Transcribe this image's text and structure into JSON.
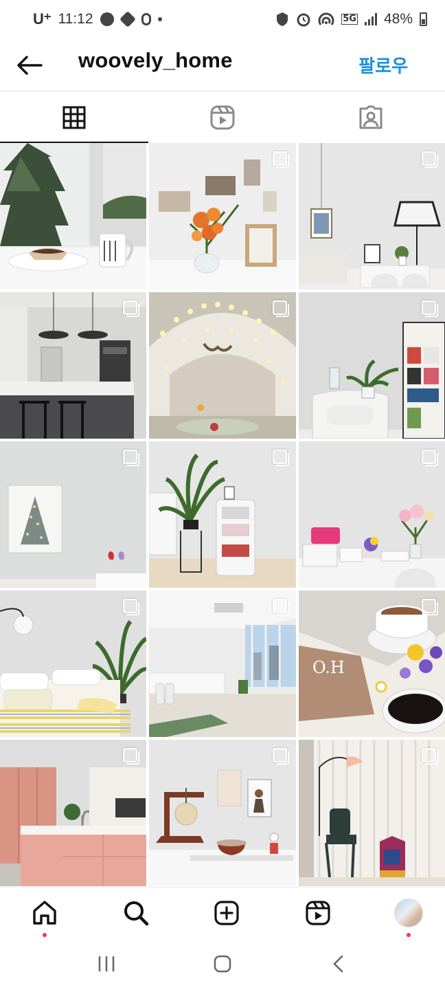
{
  "status_bar": {
    "carrier": "U⁺",
    "time": "11:12",
    "network": "5G",
    "battery": "48%"
  },
  "header": {
    "username": "woovely_home",
    "follow_label": "팔로우",
    "accent_color": "#1a8fe3"
  },
  "tabs": [
    {
      "name": "posts-grid",
      "icon": "grid-icon",
      "active": true
    },
    {
      "name": "reels",
      "icon": "reels-icon",
      "active": false
    },
    {
      "name": "tagged",
      "icon": "tagged-person-icon",
      "active": false
    }
  ],
  "posts": [
    {
      "desc": "christmas-tree-mug",
      "multi": false
    },
    {
      "desc": "orange-flowers-vase",
      "multi": true
    },
    {
      "desc": "lamp-wall-frame",
      "multi": true
    },
    {
      "desc": "kitchen-pendant-lights",
      "multi": true
    },
    {
      "desc": "string-light-tent",
      "multi": true
    },
    {
      "desc": "plant-poster-shelf",
      "multi": true
    },
    {
      "desc": "christmas-tree-canvas",
      "multi": true
    },
    {
      "desc": "palm-plant-drawers",
      "multi": true
    },
    {
      "desc": "flowers-pink-box",
      "multi": true
    },
    {
      "desc": "bedroom-yellow-bedding",
      "multi": true
    },
    {
      "desc": "bright-empty-room",
      "multi": true
    },
    {
      "desc": "coffee-flowers-magazine",
      "multi": true
    },
    {
      "desc": "pink-kitchen-island",
      "multi": true
    },
    {
      "desc": "lamp-tea-desk",
      "multi": true
    },
    {
      "desc": "chair-curtain-window",
      "multi": true
    }
  ],
  "bottom_nav": [
    {
      "name": "home",
      "icon": "home-icon",
      "notification_dot": true
    },
    {
      "name": "search",
      "icon": "search-icon",
      "notification_dot": false
    },
    {
      "name": "create",
      "icon": "add-post-icon",
      "notification_dot": false
    },
    {
      "name": "reels",
      "icon": "reels-icon",
      "notification_dot": false
    },
    {
      "name": "profile",
      "icon": "profile-avatar",
      "notification_dot": true
    }
  ],
  "system_nav": [
    "recent-apps-icon",
    "home-button-icon",
    "back-icon"
  ]
}
